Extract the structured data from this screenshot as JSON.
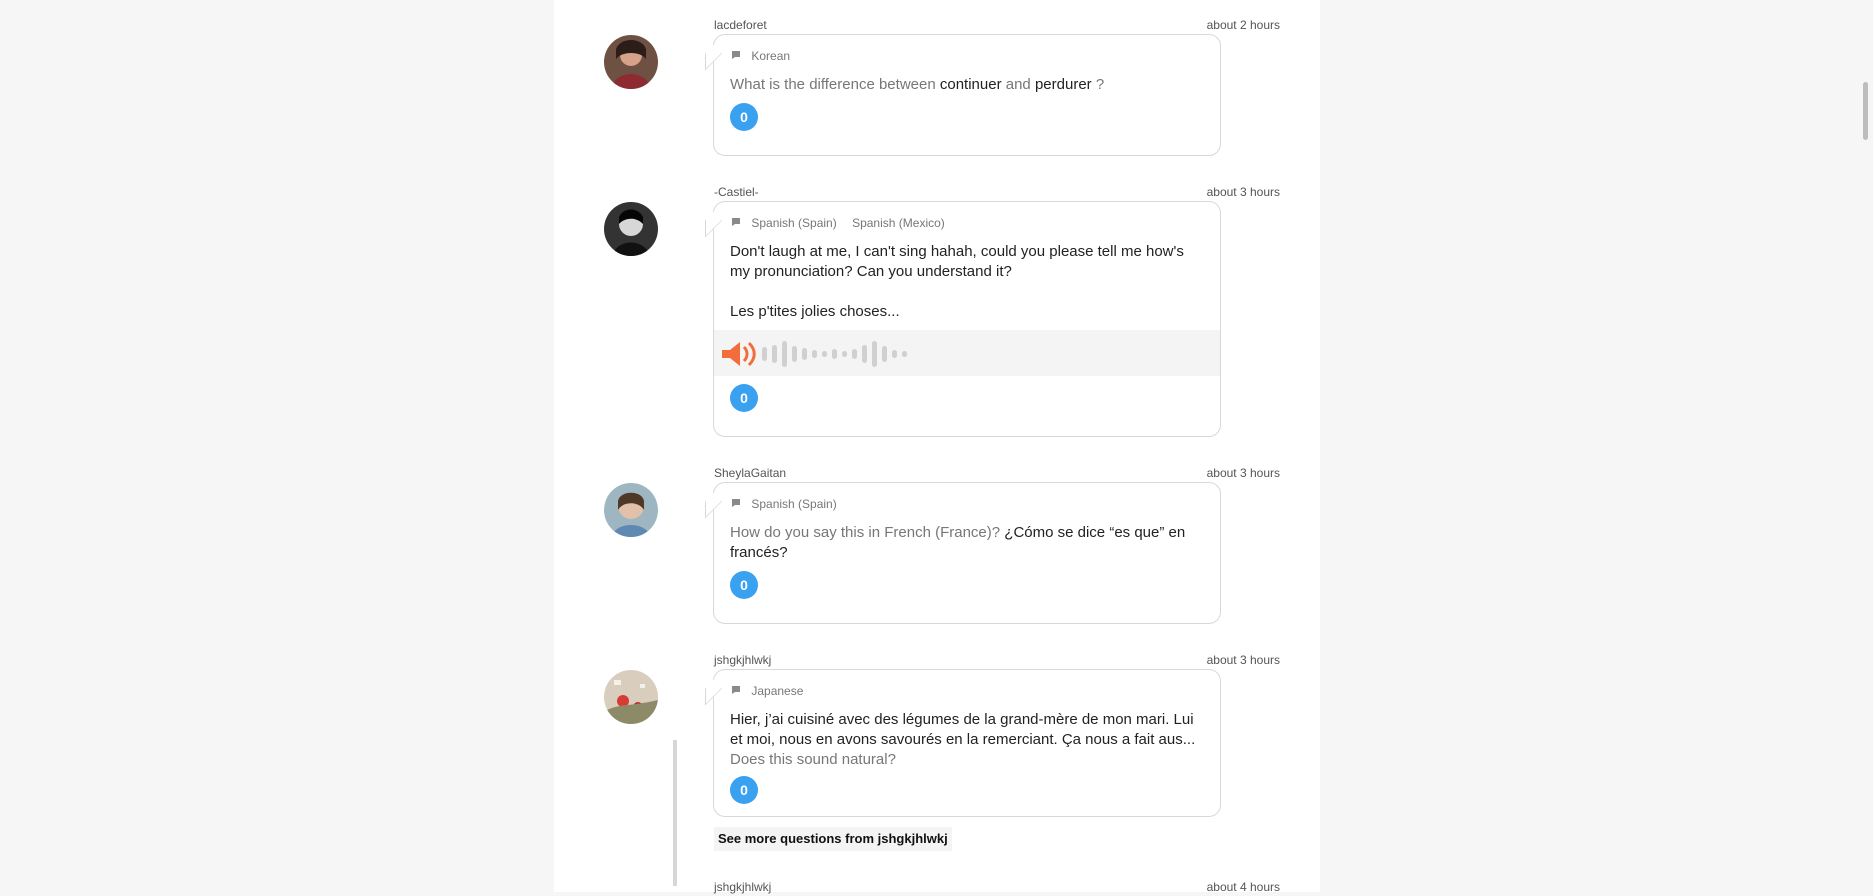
{
  "colors": {
    "accent": "#3aa0f0",
    "audio": "#f36c3c"
  },
  "icons": {
    "language": "speech-bubble-icon",
    "audio": "speaker-icon"
  },
  "questions": [
    {
      "user": "lacdeforet",
      "time": "about 2 hours",
      "languages": [
        "Korean"
      ],
      "text_pre": "What is the difference between ",
      "term1": "continuer",
      "text_mid": " and ",
      "term2": "perdurer",
      "text_post": " ?",
      "answers": "0"
    },
    {
      "user": "-Castiel-",
      "time": "about 3 hours",
      "languages": [
        "Spanish (Spain)",
        "Spanish (Mexico)"
      ],
      "line1": "Don't laugh at me, I can't sing hahah, could you please tell me how's",
      "line2": "my pronunciation? Can you understand it?",
      "line3": "Les p'tites jolies choses...",
      "answers": "0"
    },
    {
      "user": "SheylaGaitan",
      "time": "about 3 hours",
      "languages": [
        "Spanish (Spain)"
      ],
      "prefix": "How do you say this in French (France)? ",
      "phrase": "¿Cómo se dice “es que” en",
      "phrase2": "francés?",
      "answers": "0"
    },
    {
      "user": "jshgkjhlwkj",
      "time": "about 3 hours",
      "languages": [
        "Japanese"
      ],
      "line1": "Hier, j’ai cuisiné avec des légumes de la grand-mère de mon mari. Lui",
      "line2": "et moi, nous en avons savourés en la remerciant. Ça nous a fait aus...",
      "suffix": "Does this sound natural?",
      "answers": "0"
    },
    {
      "user": "jshgkjhlwkj",
      "time": "about 4 hours"
    }
  ],
  "more_link": "See more questions from jshgkjhlwkj"
}
